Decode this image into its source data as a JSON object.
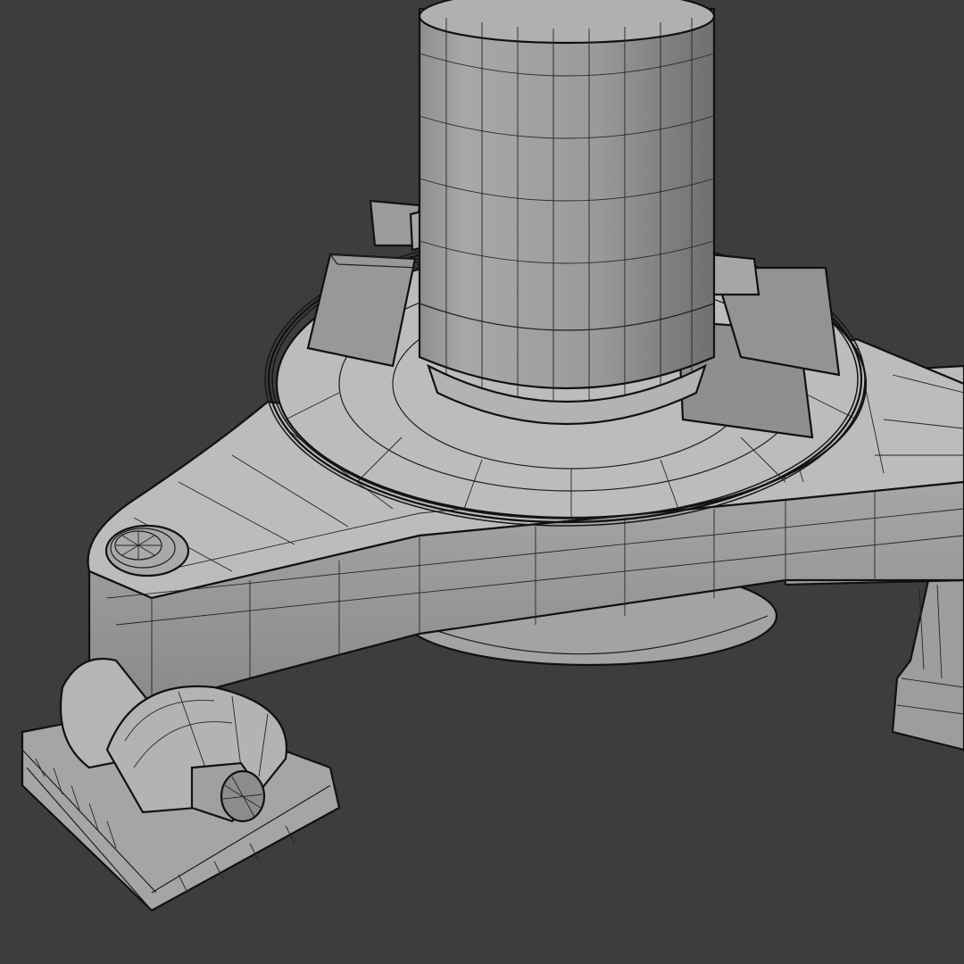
{
  "viewport": {
    "background": "#3d3d3d",
    "shading": "clay-gray",
    "wireframe_overlay": true,
    "model_parts": [
      "column",
      "ring",
      "clamp-brackets",
      "base-plate",
      "tripod-legs",
      "caster-feet"
    ]
  }
}
